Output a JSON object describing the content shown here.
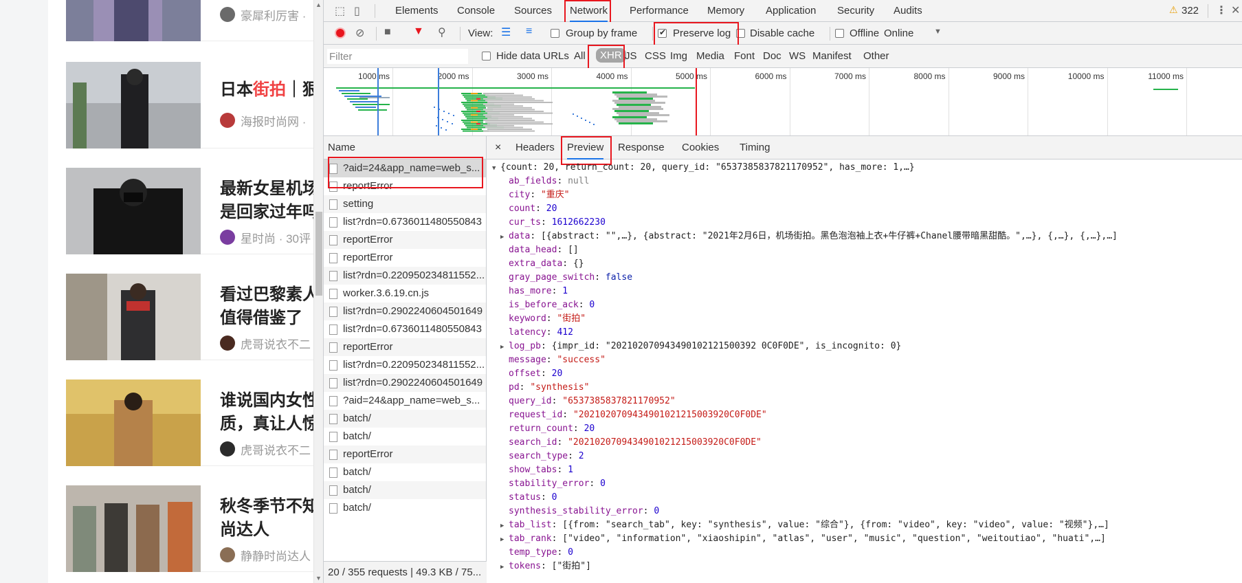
{
  "feed": {
    "items": [
      {
        "title_a": "",
        "title_hl": "",
        "title_b": "",
        "meta": "豪犀利厉害 ·"
      },
      {
        "title_a": "日本",
        "title_hl": "街拍",
        "title_b": "｜狠",
        "meta": "海报时尚网 ·"
      },
      {
        "title_a": "最新女星机场",
        "title_hl": "",
        "title_b": "",
        "title_line2": "是回家过年吗",
        "meta": "星时尚 · 30评"
      },
      {
        "title_a": "看过巴黎素人",
        "title_hl": "",
        "title_b": "",
        "title_line2": "值得借鉴了",
        "meta": "虎哥说衣不二"
      },
      {
        "title_a": "谁说国内女性",
        "title_hl": "",
        "title_b": "",
        "title_line2": "质，真让人惊",
        "meta": "虎哥说衣不二"
      },
      {
        "title_a": "秋冬季节不知",
        "title_hl": "",
        "title_b": "",
        "title_line2": "尚达人",
        "meta": "静静时尚达人"
      }
    ],
    "avatar_colors": [
      "#6a6a6a",
      "#b83a3a",
      "#7a3da0",
      "#4a2a20",
      "#2b2b2b",
      "#8a6e55"
    ]
  },
  "tabs": [
    "Elements",
    "Console",
    "Sources",
    "Network",
    "Performance",
    "Memory",
    "Application",
    "Security",
    "Audits"
  ],
  "active_tab": "Network",
  "warning_count": "322",
  "toolbar": {
    "view_label": "View:",
    "group_by_frame": "Group by frame",
    "preserve_log": "Preserve log",
    "disable_cache": "Disable cache",
    "offline": "Offline",
    "throttle": "Online"
  },
  "filter": {
    "placeholder": "Filter",
    "hide_data_urls": "Hide data URLs",
    "types": [
      "All",
      "XHR",
      "JS",
      "CSS",
      "Img",
      "Media",
      "Font",
      "Doc",
      "WS",
      "Manifest",
      "Other"
    ],
    "active_type": "XHR"
  },
  "overview": {
    "ticks": [
      "1000 ms",
      "2000 ms",
      "3000 ms",
      "4000 ms",
      "5000 ms",
      "6000 ms",
      "7000 ms",
      "8000 ms",
      "9000 ms",
      "10000 ms",
      "11000 ms",
      "1"
    ]
  },
  "requests": {
    "header": "Name",
    "rows": [
      "?aid=24&app_name=web_s...",
      "reportError",
      "setting",
      "list?rdn=0.6736011480550843",
      "reportError",
      "reportError",
      "list?rdn=0.220950234811552...",
      "worker.3.6.19.cn.js",
      "list?rdn=0.2902240604501649",
      "list?rdn=0.6736011480550843",
      "reportError",
      "list?rdn=0.220950234811552...",
      "list?rdn=0.2902240604501649",
      "?aid=24&app_name=web_s...",
      "batch/",
      "batch/",
      "reportError",
      "batch/",
      "batch/",
      "batch/"
    ],
    "status": "20 / 355 requests | 49.3 KB / 75..."
  },
  "detail_tabs": [
    "×",
    "Headers",
    "Preview",
    "Response",
    "Cookies",
    "Timing"
  ],
  "active_detail_tab": "Preview",
  "preview": {
    "summary": "{count: 20, return_count: 20, query_id: \"6537385837821170952\", has_more: 1,…}",
    "lines": [
      {
        "key": "ab_fields",
        "value": "null",
        "type": "null"
      },
      {
        "key": "city",
        "value": "\"重庆\"",
        "type": "s"
      },
      {
        "key": "count",
        "value": "20",
        "type": "n"
      },
      {
        "key": "cur_ts",
        "value": "1612662230",
        "type": "n"
      },
      {
        "key": "data",
        "value": "[{abstract: \"\",…}, {abstract: \"2021年2月6日，机场街拍。黑色泡泡袖上衣+牛仔裤+Chanel腰带暗黑甜酷。\",…}, {,…}, {,…},…]",
        "type": "plain",
        "expand": true
      },
      {
        "key": "data_head",
        "value": "[]",
        "type": "plain"
      },
      {
        "key": "extra_data",
        "value": "{}",
        "type": "plain"
      },
      {
        "key": "gray_page_switch",
        "value": "false",
        "type": "b"
      },
      {
        "key": "has_more",
        "value": "1",
        "type": "n"
      },
      {
        "key": "is_before_ack",
        "value": "0",
        "type": "n"
      },
      {
        "key": "keyword",
        "value": "\"街拍\"",
        "type": "s"
      },
      {
        "key": "latency",
        "value": "412",
        "type": "n"
      },
      {
        "key": "log_pb",
        "value": "{impr_id: \"202102070943490102121500392 0C0F0DE\", is_incognito: 0}",
        "type": "plain",
        "expand": true
      },
      {
        "key": "message",
        "value": "\"success\"",
        "type": "s"
      },
      {
        "key": "offset",
        "value": "20",
        "type": "n"
      },
      {
        "key": "pd",
        "value": "\"synthesis\"",
        "type": "s"
      },
      {
        "key": "query_id",
        "value": "\"6537385837821170952\"",
        "type": "s"
      },
      {
        "key": "request_id",
        "value": "\"2021020709434901021215003920C0F0DE\"",
        "type": "s"
      },
      {
        "key": "return_count",
        "value": "20",
        "type": "n"
      },
      {
        "key": "search_id",
        "value": "\"2021020709434901021215003920C0F0DE\"",
        "type": "s"
      },
      {
        "key": "search_type",
        "value": "2",
        "type": "n"
      },
      {
        "key": "show_tabs",
        "value": "1",
        "type": "n"
      },
      {
        "key": "stability_error",
        "value": "0",
        "type": "n"
      },
      {
        "key": "status",
        "value": "0",
        "type": "n"
      },
      {
        "key": "synthesis_stability_error",
        "value": "0",
        "type": "n"
      },
      {
        "key": "tab_list",
        "value": "[{from: \"search_tab\", key: \"synthesis\", value: \"综合\"}, {from: \"video\", key: \"video\", value: \"视频\"},…]",
        "type": "plain",
        "expand": true
      },
      {
        "key": "tab_rank",
        "value": "[\"video\", \"information\", \"xiaoshipin\", \"atlas\", \"user\", \"music\", \"question\", \"weitoutiao\", \"huati\",…]",
        "type": "plain",
        "expand": true
      },
      {
        "key": "temp_type",
        "value": "0",
        "type": "n"
      },
      {
        "key": "tokens",
        "value": "[\"街拍\"]",
        "type": "plain",
        "expand": true
      }
    ]
  }
}
